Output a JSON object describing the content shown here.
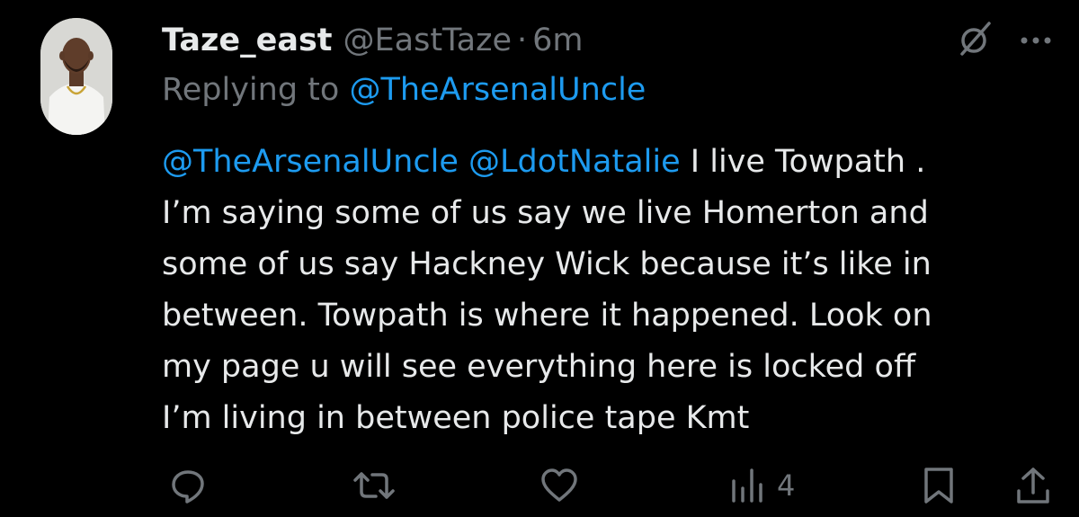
{
  "author": {
    "display_name": "Taze_east",
    "handle": "@EastTaze",
    "separator": "·",
    "timestamp": "6m"
  },
  "replying": {
    "prefix": "Replying to",
    "to": "@TheArsenalUncle"
  },
  "body": {
    "mention_1": "@TheArsenalUncle",
    "mention_2": "@LdotNatalie",
    "line_1_rest": "I live Towpath .",
    "line_2": "I’m saying some of us say we live Homerton and",
    "line_3": "some of us say Hackney Wick because it’s like in",
    "line_4": "between. Towpath is where it happened. Look on",
    "line_5": "my page u will see everything here is locked off",
    "line_6": "I’m living in between police tape Kmt"
  },
  "actions": {
    "reply_icon": "reply-icon",
    "retweet_icon": "retweet-icon",
    "like_icon": "like-icon",
    "views_icon": "views-icon",
    "views_count": "4",
    "bookmark_icon": "bookmark-icon",
    "share_icon": "share-icon"
  },
  "colors": {
    "background": "#000000",
    "text": "#e7e9ea",
    "secondary": "#71767b",
    "link": "#1d9bf0"
  }
}
